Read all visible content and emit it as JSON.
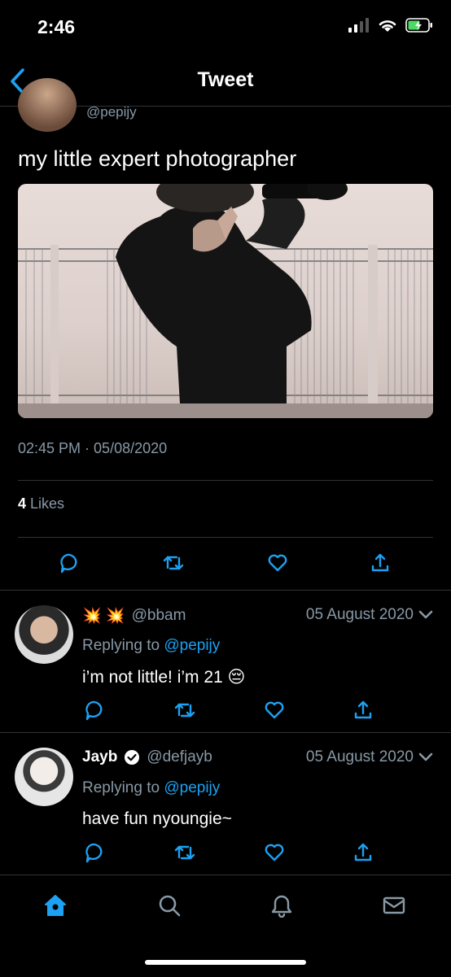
{
  "status_bar": {
    "time": "2:46"
  },
  "nav": {
    "title": "Tweet"
  },
  "tweet": {
    "handle": "@pepijy",
    "text": "my little expert photographer",
    "timestamp": "02:45 PM · 05/08/2020",
    "likes_count": "4",
    "likes_label": "Likes"
  },
  "replies": [
    {
      "name": "",
      "emoji": "💥 💥",
      "handle": "@bbam",
      "date": "05 August 2020",
      "replying_label": "Replying to",
      "replying_to": "@pepijy",
      "text": "i’m not little! i’m 21 😔"
    },
    {
      "name": "Jayb",
      "handle": "@defjayb",
      "date": "05 August 2020",
      "replying_label": "Replying to",
      "replying_to": "@pepijy",
      "text": "have fun nyoungie~"
    }
  ],
  "colors": {
    "background": "#000000",
    "accent": "#1da1f2",
    "muted": "#8899a6",
    "divider": "#2f3336"
  },
  "icons": {
    "back": "chevron-left-icon",
    "reply": "reply-icon",
    "retweet": "retweet-icon",
    "like": "heart-icon",
    "share": "share-icon",
    "home": "home-icon",
    "search": "search-icon",
    "notifications": "bell-icon",
    "messages": "mail-icon"
  }
}
